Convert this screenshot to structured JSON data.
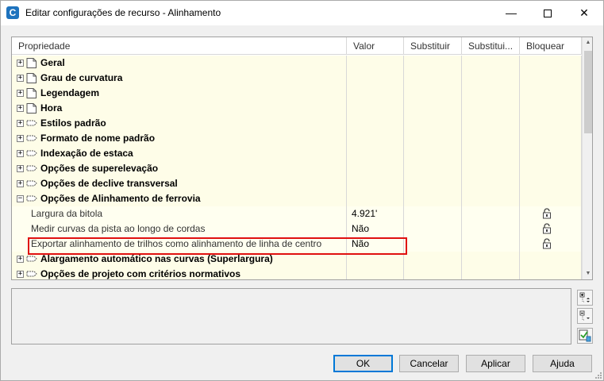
{
  "window": {
    "title": "Editar configurações de recurso - Alinhamento",
    "app_icon": "C",
    "controls": [
      "minimize-icon",
      "maximize-icon",
      "close-icon"
    ]
  },
  "grid": {
    "columns": [
      "Propriedade",
      "Valor",
      "Substituir",
      "Substitui...",
      "Bloquear"
    ],
    "categories": [
      {
        "label": "Geral",
        "icon": "page-icon",
        "expanded": false
      },
      {
        "label": "Grau de curvatura",
        "icon": "page-icon",
        "expanded": false
      },
      {
        "label": "Legendagem",
        "icon": "page-icon",
        "expanded": false
      },
      {
        "label": "Hora",
        "icon": "page-icon",
        "expanded": false
      },
      {
        "label": "Estilos padrão",
        "icon": "style-icon",
        "expanded": false
      },
      {
        "label": "Formato de nome padrão",
        "icon": "style-icon",
        "expanded": false
      },
      {
        "label": "Indexação de estaca",
        "icon": "style-icon",
        "expanded": false
      },
      {
        "label": "Opções de superelevação",
        "icon": "style-icon",
        "expanded": false
      },
      {
        "label": "Opções de declive transversal",
        "icon": "style-icon",
        "expanded": false
      },
      {
        "label": "Opções de Alinhamento de ferrovia",
        "icon": "style-icon",
        "expanded": true
      },
      {
        "label": "Alargamento automático nas curvas (Superlargura)",
        "icon": "style-icon",
        "expanded": false
      },
      {
        "label": "Opções de projeto com critérios normativos",
        "icon": "style-icon",
        "expanded": false
      }
    ],
    "rail_children": [
      {
        "label": "Largura da bitola",
        "value": "4.921'",
        "locked": true
      },
      {
        "label": "Medir curvas da pista ao longo de cordas",
        "value": "Não",
        "locked": true
      },
      {
        "label": "Exportar alinhamento de trilhos como alinhamento de linha de centro",
        "value": "Não",
        "locked": true
      }
    ]
  },
  "buttons": {
    "ok": "OK",
    "cancel": "Cancelar",
    "apply": "Aplicar",
    "help": "Ajuda"
  },
  "side_buttons": [
    "expand-all-icon",
    "collapse-all-icon",
    "toggle-override-icon"
  ],
  "colors": {
    "row_bg": "#fffff0",
    "highlight": "#e01010",
    "default_button_border": "#0078d7"
  }
}
